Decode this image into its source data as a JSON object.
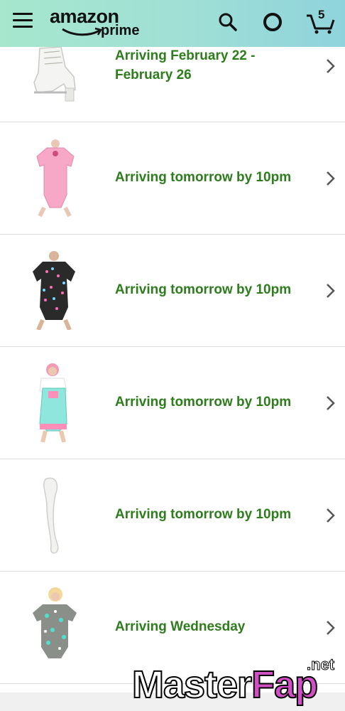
{
  "header": {
    "logo_word": "amazon",
    "logo_sub": "prime",
    "cart_count": "5"
  },
  "items": [
    {
      "arrival": "Arriving February 22 - February 26",
      "product": "white lace-up boot"
    },
    {
      "arrival": "Arriving tomorrow by 10pm",
      "product": "pink bodysuit"
    },
    {
      "arrival": "Arriving tomorrow by 10pm",
      "product": "black printed bodysuit"
    },
    {
      "arrival": "Arriving tomorrow by 10pm",
      "product": "mint overall shorts"
    },
    {
      "arrival": "Arriving tomorrow by 10pm",
      "product": "white stocking"
    },
    {
      "arrival": "Arriving Wednesday",
      "product": "grey printed bodysuit"
    }
  ],
  "watermark": {
    "master": "Master",
    "fap": "Fap",
    "net": ".net"
  },
  "colors": {
    "arrival_text": "#2d7d1c",
    "header_gradient_start": "#a6e7ce",
    "header_gradient_end": "#8fd3dc"
  }
}
